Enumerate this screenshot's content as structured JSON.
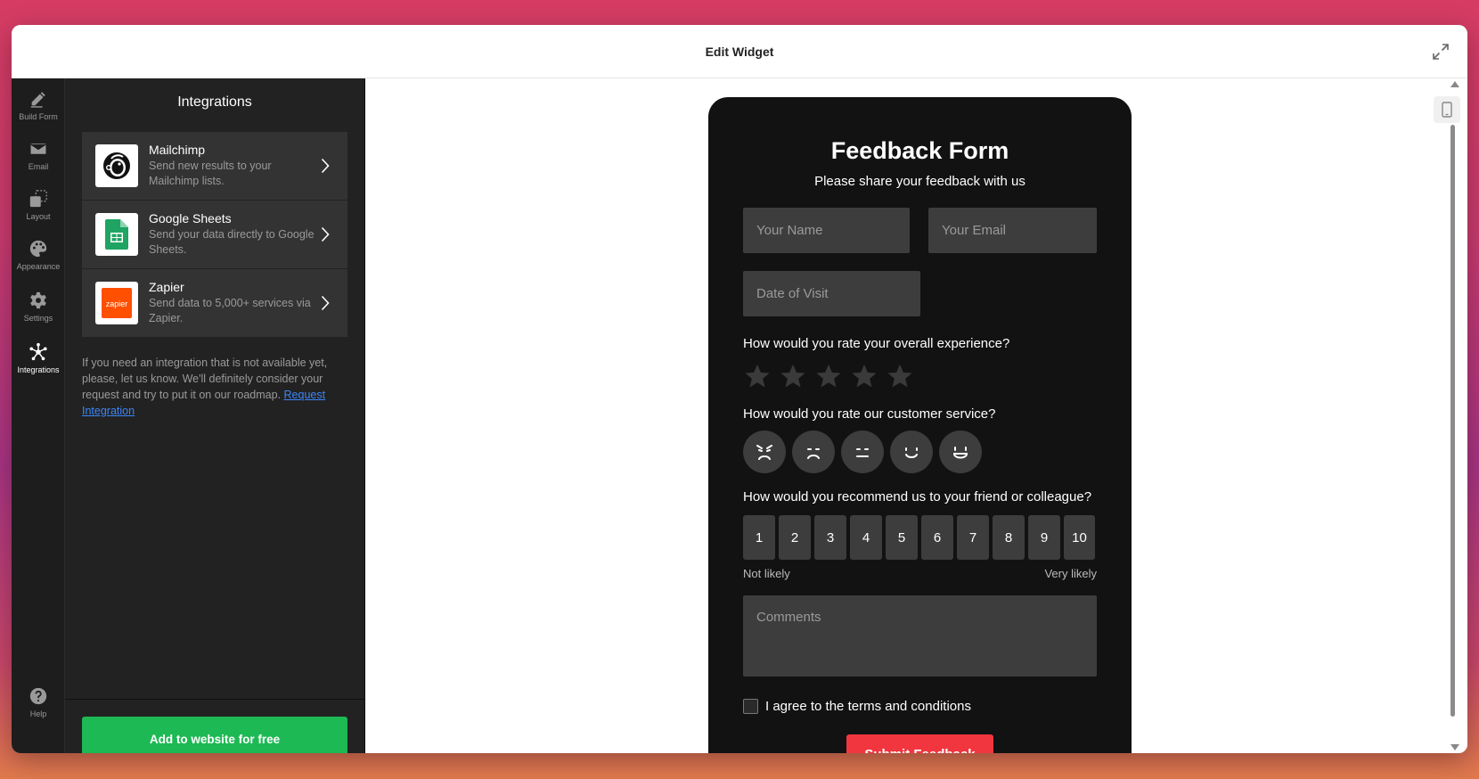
{
  "window": {
    "title": "Edit Widget"
  },
  "sidebar": {
    "items": [
      {
        "label": "Build Form",
        "icon": "pencil-icon"
      },
      {
        "label": "Email",
        "icon": "envelope-icon"
      },
      {
        "label": "Layout",
        "icon": "layout-icon"
      },
      {
        "label": "Appearance",
        "icon": "palette-icon"
      },
      {
        "label": "Settings",
        "icon": "gear-icon"
      },
      {
        "label": "Integrations",
        "icon": "integrations-icon",
        "active": true
      }
    ],
    "help": {
      "label": "Help",
      "icon": "help-icon"
    }
  },
  "panel": {
    "title": "Integrations",
    "integrations": [
      {
        "name": "Mailchimp",
        "description": "Send new results to your Mailchimp lists.",
        "icon": "mailchimp-logo"
      },
      {
        "name": "Google Sheets",
        "description": "Send your data directly to Google Sheets.",
        "icon": "google-sheets-logo"
      },
      {
        "name": "Zapier",
        "description": "Send data to 5,000+ services via Zapier.",
        "icon": "zapier-logo"
      }
    ],
    "note": "If you need an integration that is not available yet, please, let us know. We'll definitely consider your request and try to put it on our roadmap.",
    "note_link": "Request Integration",
    "cta": "Add to website for free"
  },
  "form": {
    "title": "Feedback Form",
    "subtitle": "Please share your feedback with us",
    "name_placeholder": "Your Name",
    "email_placeholder": "Your Email",
    "date_placeholder": "Date of Visit",
    "q_experience": "How would you rate your overall experience?",
    "stars_total": 5,
    "stars_selected": 0,
    "q_service": "How would you rate our customer service?",
    "q_recommend": "How would you recommend us to your friend or colleague?",
    "nps": [
      "1",
      "2",
      "3",
      "4",
      "5",
      "6",
      "7",
      "8",
      "9",
      "10"
    ],
    "nps_low": "Not likely",
    "nps_high": "Very likely",
    "comments_placeholder": "Comments",
    "agree_label": "I agree to the terms and conditions",
    "submit": "Submit Feedback"
  },
  "colors": {
    "accent_green": "#1db954",
    "submit_red": "#f1363f",
    "form_bg": "#121212",
    "panel_bg": "#222222"
  }
}
